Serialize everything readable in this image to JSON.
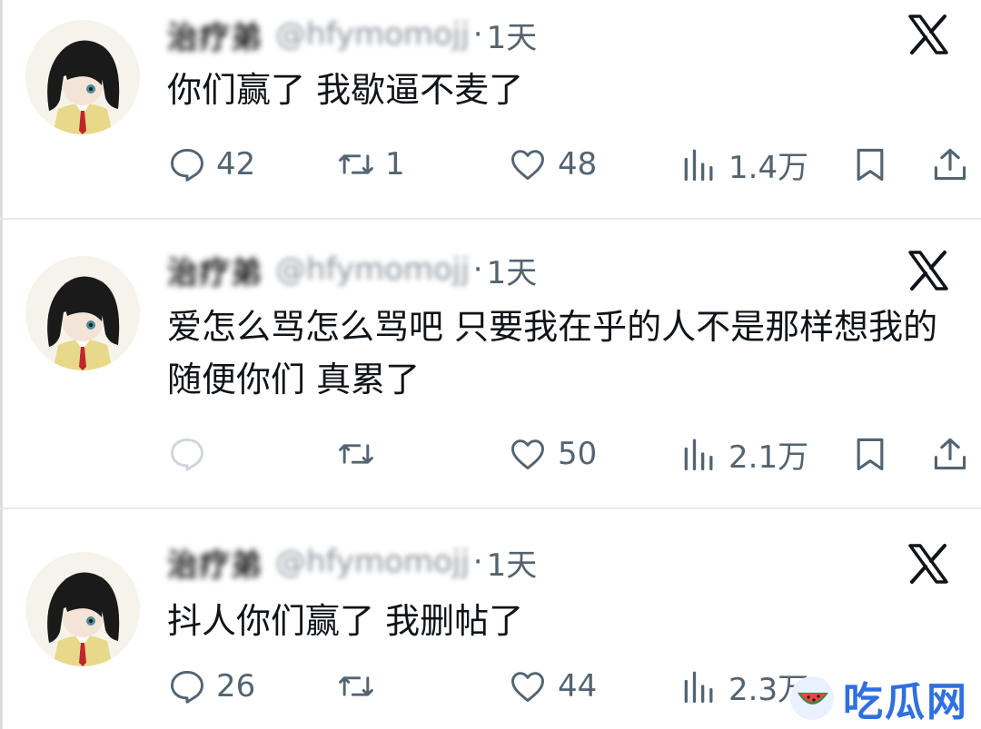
{
  "tweets": [
    {
      "display_name": "治疗弟",
      "handle": "@hfymomojj",
      "separator": "·",
      "time": "1天",
      "text": "你们赢了 我歇逼不麦了",
      "reply_count": "42",
      "retweet_count": "1",
      "like_count": "48",
      "view_count": "1.4万"
    },
    {
      "display_name": "治疗弟",
      "handle": "@hfymomojj",
      "separator": "·",
      "time": "1天",
      "text": "爱怎么骂怎么骂吧 只要我在乎的人不是那样想我的 随便你们 真累了",
      "reply_count": "",
      "retweet_count": "",
      "like_count": "50",
      "view_count": "2.1万"
    },
    {
      "display_name": "治疗弟",
      "handle": "@hfymomojj",
      "separator": "·",
      "time": "1天",
      "text": "抖人你们赢了 我删帖了",
      "reply_count": "26",
      "retweet_count": "",
      "like_count": "44",
      "view_count": "2.3万"
    }
  ],
  "icons": {
    "reply": "reply-icon",
    "retweet": "retweet-icon",
    "like": "heart-icon",
    "views": "views-icon",
    "bookmark": "bookmark-icon",
    "share": "share-icon",
    "close": "x-logo-icon"
  },
  "watermark": {
    "text": "吃瓜网"
  },
  "colors": {
    "text": "#0f1419",
    "muted": "#536471",
    "divider": "#e6e9ec",
    "watermark": "#2f6fe0"
  }
}
